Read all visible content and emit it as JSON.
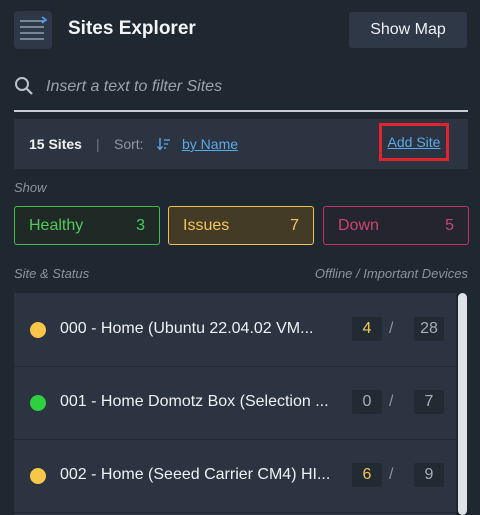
{
  "header": {
    "title": "Sites Explorer",
    "show_map_label": "Show Map"
  },
  "search": {
    "placeholder": "Insert a text to filter Sites"
  },
  "toolbar": {
    "site_count": "15 Sites",
    "divider": "|",
    "sort_label": "Sort:",
    "sort_value": "by Name",
    "add_site_label": "Add Site"
  },
  "filters": {
    "show_label": "Show",
    "healthy": {
      "label": "Healthy",
      "count": "3",
      "color": "#3fbf4a"
    },
    "issues": {
      "label": "Issues",
      "count": "7",
      "color": "#f1c24b"
    },
    "down": {
      "label": "Down",
      "count": "5",
      "color": "#c1316a"
    }
  },
  "columns": {
    "left": "Site & Status",
    "right": "Offline / Important Devices"
  },
  "sites": [
    {
      "name": "000 - Home (Ubuntu 22.04.02 VM...",
      "status_color": "#f8c648",
      "offline": "4",
      "offline_color": "#f3c758",
      "slash": "/",
      "important": "28"
    },
    {
      "name": "001 - Home Domotz Box (Selection ...",
      "status_color": "#2fd03f",
      "offline": "0",
      "offline_color": "#a6afba",
      "slash": "/",
      "important": "7"
    },
    {
      "name": "002 - Home (Seeed Carrier CM4) HI...",
      "status_color": "#f8c648",
      "offline": "6",
      "offline_color": "#f3c758",
      "slash": "/",
      "important": "9"
    }
  ]
}
